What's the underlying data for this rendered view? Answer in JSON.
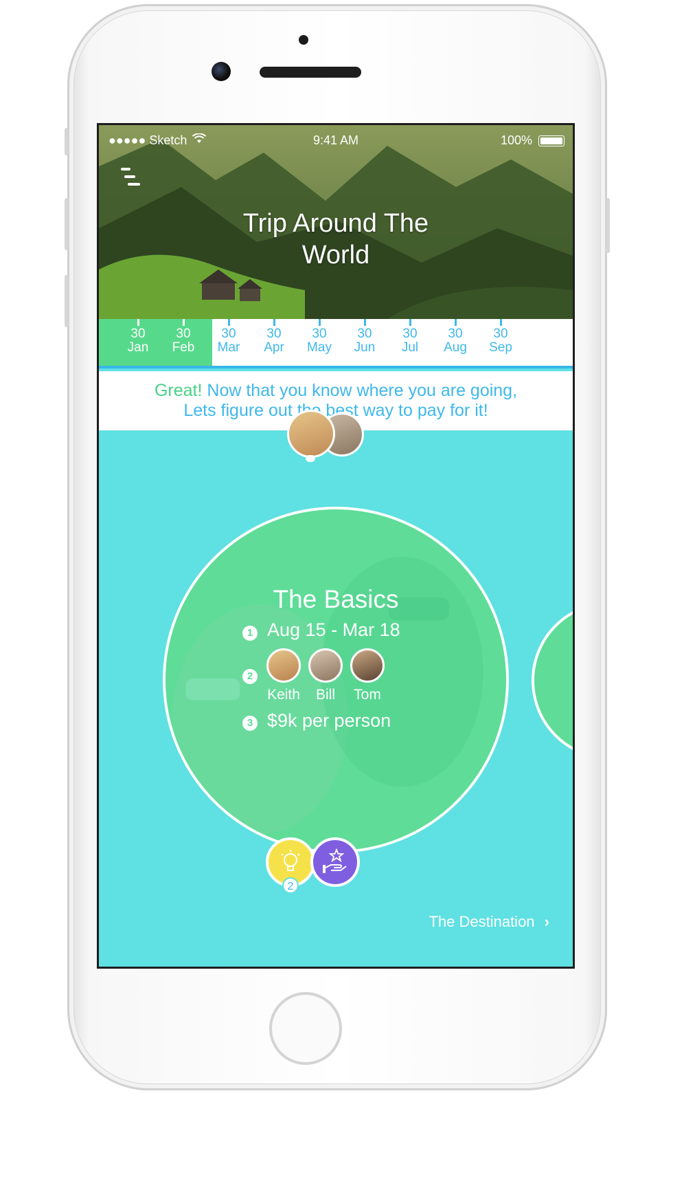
{
  "status_bar": {
    "carrier": "●●●●● Sketch",
    "time": "9:41 AM",
    "battery": "100%"
  },
  "header": {
    "title_line1": "Trip Around The",
    "title_line2": "World"
  },
  "timeline": {
    "months": [
      {
        "day": "30",
        "month": "Jan"
      },
      {
        "day": "30",
        "month": "Feb"
      },
      {
        "day": "30",
        "month": "Mar"
      },
      {
        "day": "30",
        "month": "Apr"
      },
      {
        "day": "30",
        "month": "May"
      },
      {
        "day": "30",
        "month": "Jun"
      },
      {
        "day": "30",
        "month": "Jul"
      },
      {
        "day": "30",
        "month": "Aug"
      },
      {
        "day": "30",
        "month": "Sep"
      }
    ]
  },
  "banner": {
    "great": "Great!",
    "line1_rest": " Now that you know where you are going,",
    "line2": "Lets figure out the best way to pay for it!"
  },
  "card": {
    "title": "The Basics",
    "steps": [
      {
        "num": "1",
        "text": "Aug 15 - Mar 18"
      },
      {
        "num": "2"
      },
      {
        "num": "3",
        "text": "$9k per person"
      }
    ],
    "people": [
      "Keith",
      "Bill",
      "Tom"
    ]
  },
  "tips_badge_count": "2",
  "footer": {
    "next_label": "The Destination",
    "chevron": "›"
  },
  "colors": {
    "screen_bg": "#5fe0e2",
    "green": "#5edc98",
    "accent_blue": "#3fb8ea",
    "yellow": "#f5e24a",
    "purple": "#7f5fe0"
  }
}
